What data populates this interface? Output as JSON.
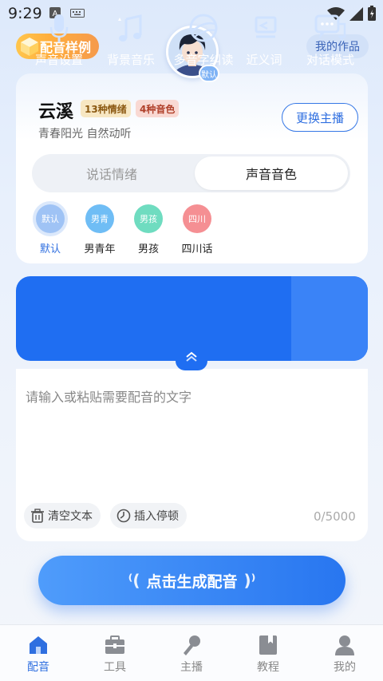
{
  "status": {
    "time": "9:29"
  },
  "header": {
    "sample_label": "配音样例",
    "works_label": "我的作品",
    "avatar_badge": "默认"
  },
  "anchor": {
    "name": "云溪",
    "emotion_tag": "13种情绪",
    "tone_tag": "4种音色",
    "description": "青春阳光 自然动听",
    "change_label": "更换主播"
  },
  "segment": {
    "left": "说话情绪",
    "right": "声音音色",
    "selected": "声音音色"
  },
  "voices": [
    {
      "circle": "默认",
      "label": "默认",
      "color": "#9fc3f5",
      "selected": true
    },
    {
      "circle": "男青",
      "label": "男青年",
      "color": "#6fbdf5"
    },
    {
      "circle": "男孩",
      "label": "男孩",
      "color": "#6fdcc0"
    },
    {
      "circle": "四川",
      "label": "四川话",
      "color": "#f58f93"
    }
  ],
  "tools": [
    {
      "label": "声音设置",
      "icon": "microphone-icon"
    },
    {
      "label": "背景音乐",
      "icon": "music-icon"
    },
    {
      "label": "多音字纠读",
      "icon": "globe-icon"
    },
    {
      "label": "近义词",
      "icon": "synonym-icon"
    },
    {
      "label": "对话模式",
      "icon": "chat-icon",
      "active": true
    }
  ],
  "editor": {
    "placeholder": "请输入或粘贴需要配音的文字",
    "clear_label": "清空文本",
    "pause_label": "插入停顿",
    "counter": "0/5000"
  },
  "generate_label": "点击生成配音",
  "nav": [
    {
      "label": "配音",
      "icon": "home-icon",
      "active": true
    },
    {
      "label": "工具",
      "icon": "toolbox-icon"
    },
    {
      "label": "主播",
      "icon": "mic-icon"
    },
    {
      "label": "教程",
      "icon": "book-icon"
    },
    {
      "label": "我的",
      "icon": "profile-icon"
    }
  ],
  "colors": {
    "primary": "#1f6ef2",
    "accent_orange": "#ffae3d"
  }
}
